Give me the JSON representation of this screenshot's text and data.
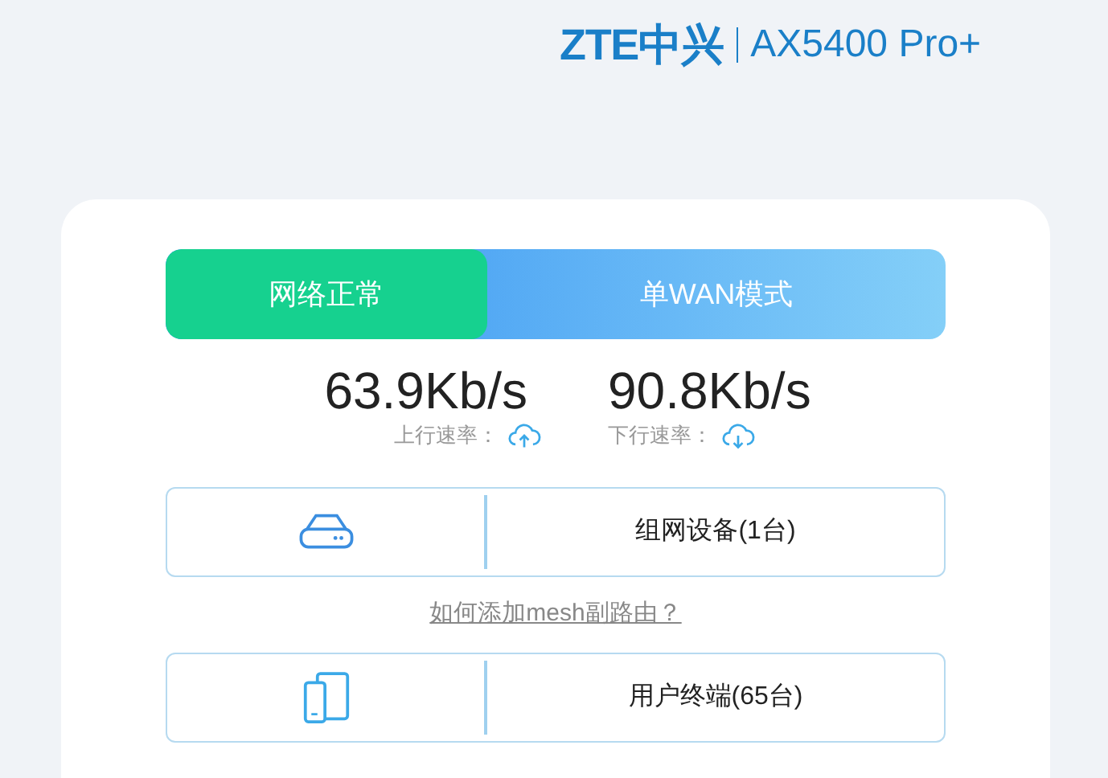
{
  "header": {
    "brand": "ZTE中兴",
    "model": "AX5400 Pro+"
  },
  "status": [
    {
      "kind": "network",
      "label": "网络正常"
    },
    {
      "kind": "mode",
      "label": "单WAN模式"
    }
  ],
  "speeds": [
    {
      "kind": "upload",
      "value": "63.9Kb/s",
      "label": "上行速率："
    },
    {
      "kind": "download",
      "value": "90.8Kb/s",
      "label": "下行速率："
    }
  ],
  "devices": [
    {
      "kind": "mesh",
      "label": "组网设备(1台)"
    },
    {
      "kind": "clients",
      "label": "用户终端(65台)"
    }
  ],
  "help_link": "如何添加mesh副路由？"
}
